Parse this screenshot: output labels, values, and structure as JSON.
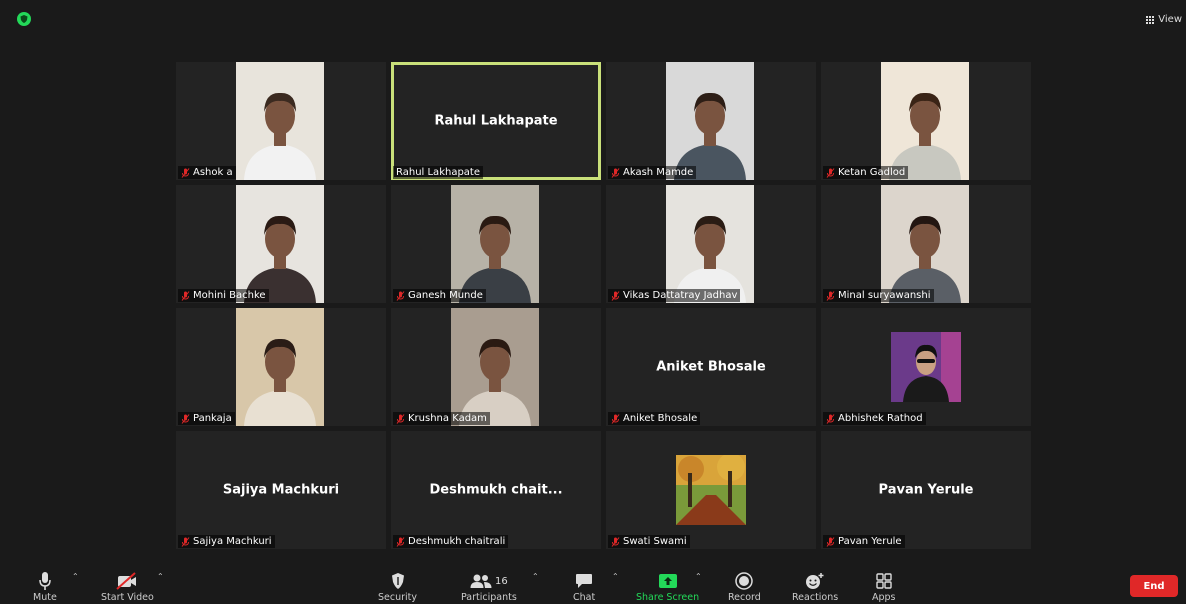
{
  "top": {
    "view_label": "View"
  },
  "tiles": [
    {
      "name": "Ashok a",
      "display": "",
      "type": "video",
      "palette": [
        "#e8e4dc",
        "#3b2a20",
        "#f2f2f2"
      ]
    },
    {
      "name": "Rahul Lakhapate",
      "display": "Rahul Lakhapate",
      "type": "name",
      "active": true
    },
    {
      "name": "Akash Mamde",
      "display": "",
      "type": "video",
      "palette": [
        "#d9d9d9",
        "#2d1e16",
        "#4a5560"
      ]
    },
    {
      "name": "Ketan Gadlod",
      "display": "",
      "type": "video",
      "palette": [
        "#efe6d8",
        "#3a2416",
        "#c8c8c0"
      ]
    },
    {
      "name": "Mohini Bachke",
      "display": "",
      "type": "video",
      "palette": [
        "#e7e4df",
        "#2a1a14",
        "#3a3030"
      ]
    },
    {
      "name": "Ganesh Munde",
      "display": "",
      "type": "video",
      "palette": [
        "#b7b2a7",
        "#2a1a12",
        "#3a3f45"
      ]
    },
    {
      "name": "Vikas Dattatray Jadhav",
      "display": "",
      "type": "video",
      "palette": [
        "#e5e3de",
        "#2a1c14",
        "#f0f0f0"
      ]
    },
    {
      "name": "Minal suryawanshi",
      "display": "",
      "type": "video",
      "palette": [
        "#dcd5cc",
        "#231611",
        "#5a5f66"
      ]
    },
    {
      "name": "Pankaja",
      "display": "",
      "type": "video",
      "palette": [
        "#d8c7a9",
        "#2a1c16",
        "#e8e0d2"
      ]
    },
    {
      "name": "Krushna Kadam",
      "display": "",
      "type": "video",
      "palette": [
        "#a99d90",
        "#2a1a12",
        "#d8cfc4"
      ]
    },
    {
      "name": "Aniket Bhosale",
      "display": "Aniket Bhosale",
      "type": "name"
    },
    {
      "name": "Abhishek Rathod",
      "display": "",
      "type": "avatar",
      "palette": [
        "#6b3a8a",
        "#1a1a1a",
        "#e04a9a"
      ]
    },
    {
      "name": "Sajiya Machkuri",
      "display": "Sajiya Machkuri",
      "type": "name"
    },
    {
      "name": "Deshmukh chaitrali",
      "display": "Deshmukh  chait...",
      "type": "name"
    },
    {
      "name": "Swati Swami",
      "display": "",
      "type": "avatar",
      "palette": [
        "#c9862a",
        "#7a9a3a",
        "#8a3a1a"
      ]
    },
    {
      "name": "Pavan Yerule",
      "display": "Pavan Yerule",
      "type": "name"
    }
  ],
  "toolbar": {
    "mute": "Mute",
    "start_video": "Start Video",
    "security": "Security",
    "participants": "Participants",
    "participant_count": "16",
    "chat": "Chat",
    "share_screen": "Share Screen",
    "record": "Record",
    "reactions": "Reactions",
    "apps": "Apps",
    "end": "End"
  },
  "colors": {
    "accent_green": "#23d959",
    "end_red": "#e02828",
    "active_border": "#c9e07a"
  }
}
